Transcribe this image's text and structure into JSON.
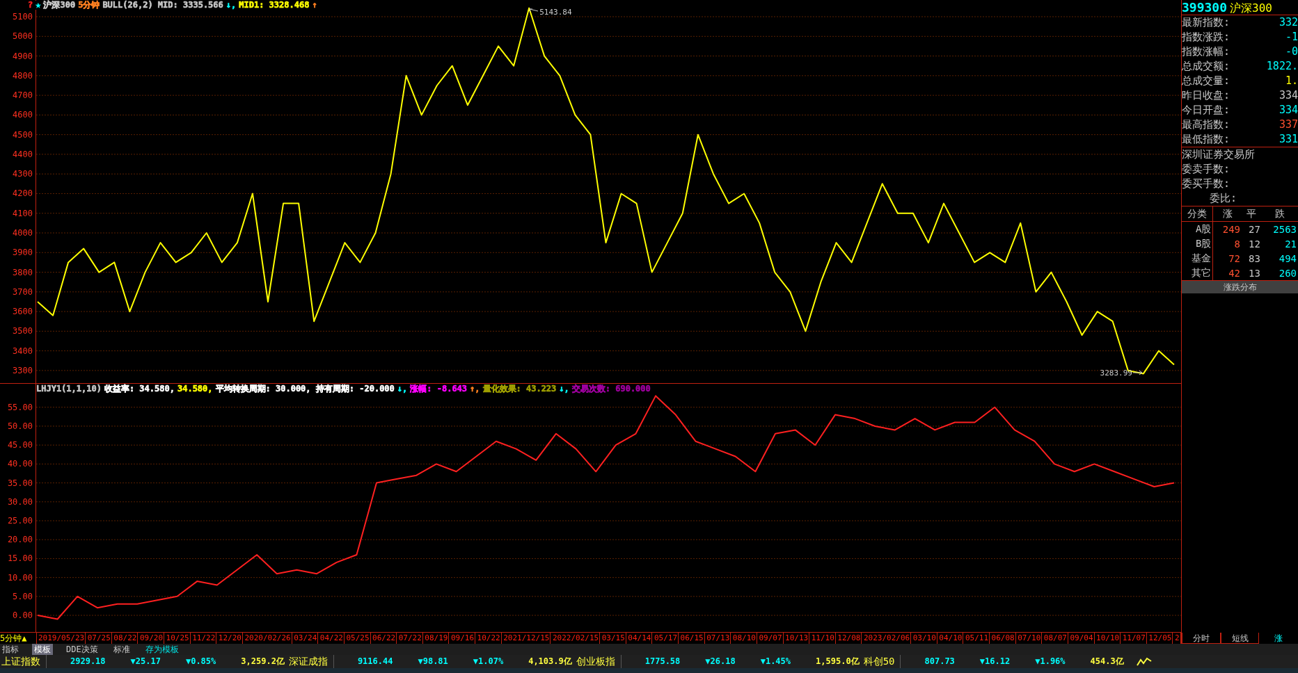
{
  "top_chart": {
    "header": [
      {
        "text": "?",
        "color": "#ff2020"
      },
      {
        "text": "★",
        "color": "#00ffff"
      },
      {
        "text": "沪深300",
        "color": "#c8c8c8"
      },
      {
        "text": "5分钟",
        "color": "#ff8020"
      },
      {
        "text": "BULL(26,2) MID: 3335.566",
        "color": "#c8c8c8"
      },
      {
        "text": "↓,",
        "color": "#00ffff"
      },
      {
        "text": "MID1: 3328.468",
        "color": "#ffff00"
      },
      {
        "text": "↑",
        "color": "#ff8020"
      }
    ],
    "price_labels": [
      "5143.84",
      "3283.99"
    ],
    "chart_data": {
      "type": "line",
      "grid": true,
      "ylim": [
        3236,
        5185
      ],
      "yticks": [
        3300,
        3400,
        3500,
        3600,
        3700,
        3800,
        3900,
        4000,
        4100,
        4200,
        4300,
        4400,
        4500,
        4600,
        4700,
        4800,
        4900,
        5000,
        5100
      ],
      "series": [
        {
          "color": "#ffff00",
          "values": [
            3650,
            3580,
            3850,
            3920,
            3800,
            3850,
            3600,
            3800,
            3950,
            3850,
            3900,
            4000,
            3850,
            3950,
            4200,
            3650,
            4150,
            4150,
            3550,
            3750,
            3950,
            3850,
            4000,
            4300,
            4800,
            4600,
            4750,
            4850,
            4650,
            4800,
            4950,
            4850,
            5144,
            4900,
            4800,
            4600,
            4500,
            3950,
            4200,
            4150,
            3800,
            3950,
            4100,
            4500,
            4300,
            4150,
            4200,
            4050,
            3800,
            3700,
            3500,
            3750,
            3950,
            3850,
            4050,
            4250,
            4100,
            4100,
            3950,
            4150,
            4000,
            3850,
            3900,
            3850,
            4050,
            3700,
            3800,
            3650,
            3480,
            3600,
            3550,
            3300,
            3284,
            3400,
            3330
          ]
        }
      ]
    }
  },
  "lower_chart": {
    "header": [
      {
        "text": "LHJY1(1,1,10)",
        "color": "#c8c8c8"
      },
      {
        "text": "收益率: 34.580,",
        "color": "#ffffff"
      },
      {
        "text": "34.580,",
        "color": "#ffff00"
      },
      {
        "text": "平均转换周期: 30.000, 持有周期: -20.000",
        "color": "#ffffff"
      },
      {
        "text": "↓,",
        "color": "#00ffff"
      },
      {
        "text": "涨幅: -8.643",
        "color": "#ff00ff"
      },
      {
        "text": "↑,",
        "color": "#ff8020"
      },
      {
        "text": "量化效果: 43.223",
        "color": "#a0a000"
      },
      {
        "text": "↓,",
        "color": "#00ffff"
      },
      {
        "text": "交易次数: 690.000",
        "color": "#a000a0"
      }
    ],
    "chart_data": {
      "type": "line",
      "grid": true,
      "ylim": [
        -4.4,
        61.2
      ],
      "yticks": [
        {
          "value": 0,
          "label": "0.00"
        },
        {
          "value": 5,
          "label": "5.00"
        },
        {
          "value": 10,
          "label": "10.00"
        },
        {
          "value": 15,
          "label": "15.00"
        },
        {
          "value": 20,
          "label": "20.00"
        },
        {
          "value": 25,
          "label": "25.00"
        },
        {
          "value": 30,
          "label": "30.00"
        },
        {
          "value": 35,
          "label": "35.00"
        },
        {
          "value": 40,
          "label": "40.00"
        },
        {
          "value": 45,
          "label": "45.00"
        },
        {
          "value": 50,
          "label": "50.00"
        },
        {
          "value": 55,
          "label": "55.00"
        }
      ],
      "series": [
        {
          "color": "#ff2020",
          "values": [
            0,
            -1,
            5,
            2,
            3,
            3,
            4,
            5,
            9,
            8,
            12,
            16,
            11,
            12,
            11,
            14,
            16,
            35,
            36,
            37,
            40,
            38,
            42,
            46,
            44,
            41,
            48,
            44,
            38,
            45,
            48,
            58,
            53,
            46,
            44,
            42,
            38,
            48,
            49,
            45,
            53,
            52,
            50,
            49,
            52,
            49,
            51,
            51,
            55,
            49,
            46,
            40,
            38,
            40,
            38,
            36,
            34,
            35
          ]
        }
      ]
    }
  },
  "period": "5分钟▲",
  "dates": [
    "2019/05/23",
    "07/25",
    "08/22",
    "09/20",
    "10/25",
    "11/22",
    "12/20",
    "2020/02/26",
    "03/24",
    "04/22",
    "05/25",
    "06/22",
    "07/22",
    "08/19",
    "09/16",
    "10/22",
    "2021/12/15",
    "2022/02/15",
    "03/15",
    "04/14",
    "05/17",
    "06/15",
    "07/13",
    "08/10",
    "09/07",
    "10/13",
    "11/10",
    "12/08",
    "2023/02/06",
    "03/10",
    "04/10",
    "05/11",
    "06/08",
    "07/10",
    "08/07",
    "09/04",
    "10/10",
    "11/07",
    "12/05",
    "2"
  ],
  "template_bar": [
    {
      "label": "指标",
      "kind": "tab",
      "selected": false
    },
    {
      "label": "模板",
      "kind": "tab",
      "selected": true
    },
    {
      "label": "DDE决策",
      "kind": "tab",
      "selected": false
    },
    {
      "label": "标准",
      "kind": "tab",
      "selected": false
    },
    {
      "label": "存为模板",
      "kind": "action",
      "selected": false
    }
  ],
  "side_panel": {
    "code": "399300",
    "name": "沪深300",
    "quote": [
      {
        "label": "最新指数:",
        "value": "332",
        "color": "#00ffff"
      },
      {
        "label": "指数涨跌:",
        "value": "-1",
        "color": "#00ffff"
      },
      {
        "label": "指数涨幅:",
        "value": "-0",
        "color": "#00ffff"
      },
      {
        "label": "总成交额:",
        "value": "1822.",
        "color": "#00ffff"
      },
      {
        "label": "总成交量:",
        "value": "1.",
        "color": "#ffff00"
      },
      {
        "label": "昨日收盘:",
        "value": "334",
        "color": "#c8c8c8"
      },
      {
        "label": "今日开盘:",
        "value": "334",
        "color": "#00ffff"
      },
      {
        "label": "最高指数:",
        "value": "337",
        "color": "#ff5030"
      },
      {
        "label": "最低指数:",
        "value": "331",
        "color": "#00ffff"
      }
    ],
    "exchange": "深圳证券交易所",
    "orders": [
      "委卖手数:",
      "委买手数:",
      "委比:"
    ],
    "table": {
      "columns": [
        "分类",
        "涨",
        "平",
        "跌"
      ],
      "rows": [
        [
          "A股",
          "249",
          "27",
          "2563"
        ],
        [
          "B股",
          "8",
          "12",
          "21"
        ],
        [
          "基金",
          "72",
          "83",
          "494"
        ],
        [
          "其它",
          "42",
          "13",
          "260"
        ]
      ]
    },
    "footer": "涨跌分布",
    "tabs": [
      {
        "label": "分时",
        "selected": false
      },
      {
        "label": "短线",
        "selected": false
      },
      {
        "label": "涨",
        "selected": true
      }
    ]
  },
  "ticker": [
    {
      "text": "上证指数",
      "kind": "name"
    },
    {
      "text": "2929.18",
      "kind": "price"
    },
    {
      "text": "▼25.17",
      "kind": "change"
    },
    {
      "text": "▼0.85%",
      "kind": "change"
    },
    {
      "text": "3,259.2亿",
      "kind": "amount"
    },
    {
      "text": "深证成指",
      "kind": "name"
    },
    {
      "text": "9116.44",
      "kind": "price"
    },
    {
      "text": "▼98.81",
      "kind": "change"
    },
    {
      "text": "▼1.07%",
      "kind": "change"
    },
    {
      "text": "4,103.9亿",
      "kind": "amount"
    },
    {
      "text": "创业板指",
      "kind": "name"
    },
    {
      "text": "1775.58",
      "kind": "price"
    },
    {
      "text": "▼26.18",
      "kind": "change"
    },
    {
      "text": "▼1.45%",
      "kind": "change"
    },
    {
      "text": "1,595.0亿",
      "kind": "amount"
    },
    {
      "text": "科创50",
      "kind": "name"
    },
    {
      "text": "807.73",
      "kind": "price"
    },
    {
      "text": "▼16.12",
      "kind": "change"
    },
    {
      "text": "▼1.96%",
      "kind": "change"
    },
    {
      "text": "454.3亿",
      "kind": "amount"
    }
  ]
}
